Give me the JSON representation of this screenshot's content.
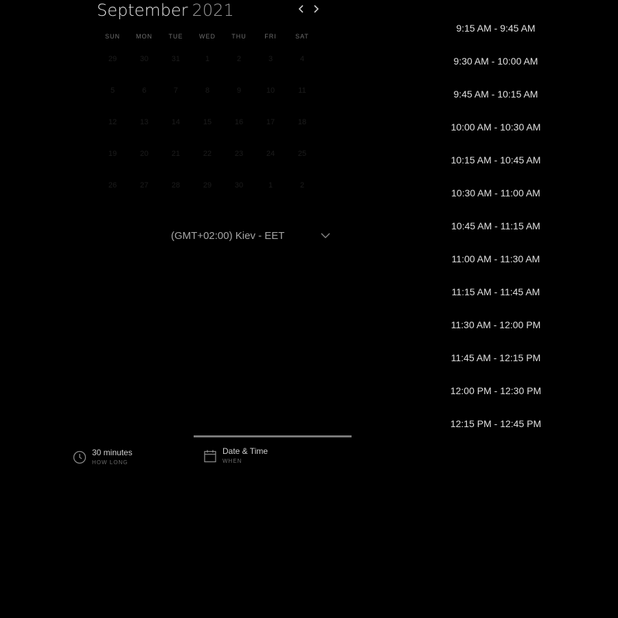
{
  "calendar": {
    "month": "September",
    "year": "2021",
    "weekdays": [
      "SUN",
      "MON",
      "TUE",
      "WED",
      "THU",
      "FRI",
      "SAT"
    ],
    "days": [
      "29",
      "30",
      "31",
      "1",
      "2",
      "3",
      "4",
      "5",
      "6",
      "7",
      "8",
      "9",
      "10",
      "11",
      "12",
      "13",
      "14",
      "15",
      "16",
      "17",
      "18",
      "19",
      "20",
      "21",
      "22",
      "23",
      "24",
      "25",
      "26",
      "27",
      "28",
      "29",
      "30",
      "1",
      "2"
    ]
  },
  "timezone": {
    "label": "(GMT+02:00) Kiev - EET"
  },
  "time_slots": [
    "9:15 AM - 9:45 AM",
    "9:30 AM - 10:00 AM",
    "9:45 AM - 10:15 AM",
    "10:00 AM - 10:30 AM",
    "10:15 AM - 10:45 AM",
    "10:30 AM - 11:00 AM",
    "10:45 AM - 11:15 AM",
    "11:00 AM - 11:30 AM",
    "11:15 AM - 11:45 AM",
    "11:30 AM - 12:00 PM",
    "11:45 AM - 12:15 PM",
    "12:00 PM - 12:30 PM",
    "12:15 PM - 12:45 PM"
  ],
  "steps": [
    {
      "title": "30 minutes",
      "subtitle": "HOW LONG",
      "icon": "clock-icon"
    },
    {
      "title": "Date & Time",
      "subtitle": "WHEN",
      "icon": "calendar-icon"
    }
  ],
  "colors": {
    "background": "#000000",
    "text": "#e0e0e0",
    "muted": "#6f6f6f",
    "progress": "#7a7a7a"
  }
}
